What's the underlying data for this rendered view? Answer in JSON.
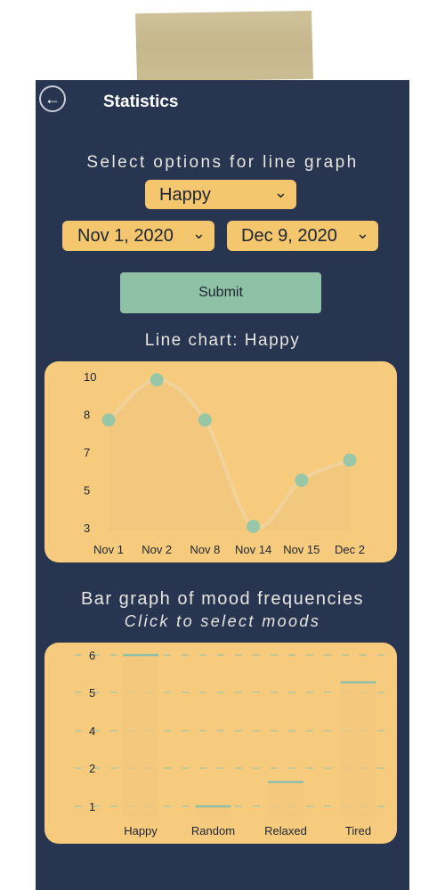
{
  "header": {
    "title": "Statistics",
    "back_icon": "back-arrow-icon"
  },
  "controls": {
    "heading": "Select options for line graph",
    "mood_select": "Happy",
    "start_date": "Nov 1, 2020",
    "end_date": "Dec 9, 2020",
    "submit_label": "Submit"
  },
  "line_section": {
    "heading": "Line chart: Happy"
  },
  "bar_section": {
    "heading": "Bar graph of mood frequencies",
    "subheading": "Click to select moods"
  },
  "colors": {
    "panel": "#273550",
    "card": "#f6cb7d",
    "dropdown": "#f4c66e",
    "accent": "#8fc1a7",
    "text_light": "#e8e6e1"
  },
  "chart_data": [
    {
      "type": "line",
      "categories": [
        "Nov 1",
        "Nov 2",
        "Nov 8",
        "Nov 14",
        "Nov 15",
        "Dec 2"
      ],
      "values": [
        8,
        10,
        8,
        2.7,
        5,
        6
      ],
      "yticks": [
        10,
        8,
        7,
        5,
        3
      ],
      "ylim": [
        2.5,
        10.3
      ]
    },
    {
      "type": "bar",
      "categories": [
        "Happy",
        "Random",
        "Relaxed",
        "Tired"
      ],
      "values": [
        6,
        1,
        1.8,
        5.1
      ],
      "yticks": [
        6,
        5,
        4,
        2,
        1
      ],
      "grid": true
    }
  ]
}
